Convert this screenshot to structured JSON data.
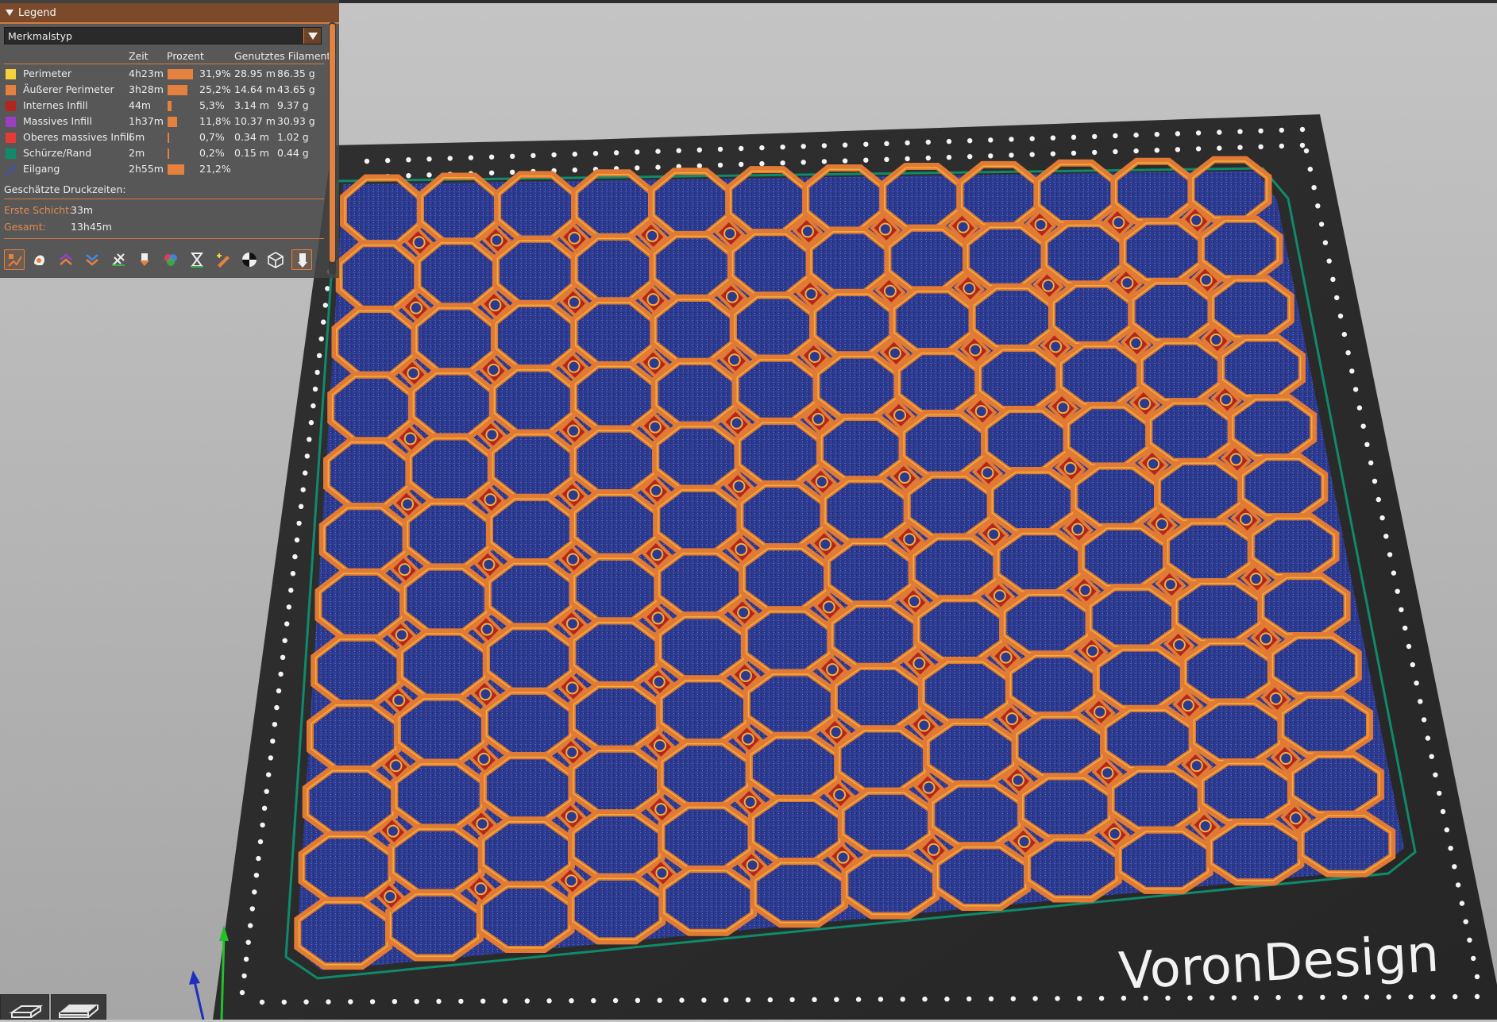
{
  "legend": {
    "title": "Legend",
    "view_type": "Merkmalstyp",
    "columns": {
      "time": "Zeit",
      "percent": "Prozent",
      "filament": "Genutztes Filament"
    },
    "rows": [
      {
        "label": "Perimeter",
        "color": "#f5d33d",
        "time": "4h23m",
        "percent": "31,9%",
        "percent_value": 31.9,
        "length": "28.95 m",
        "weight": "86.35 g"
      },
      {
        "label": "Äußerer Perimeter",
        "color": "#e5813e",
        "time": "3h28m",
        "percent": "25,2%",
        "percent_value": 25.2,
        "length": "14.64 m",
        "weight": "43.65 g"
      },
      {
        "label": "Internes Infill",
        "color": "#b3261e",
        "time": "44m",
        "percent": "5,3%",
        "percent_value": 5.3,
        "length": "3.14 m",
        "weight": "9.37 g"
      },
      {
        "label": "Massives Infill",
        "color": "#9a3fc4",
        "time": "1h37m",
        "percent": "11,8%",
        "percent_value": 11.8,
        "length": "10.37 m",
        "weight": "30.93 g"
      },
      {
        "label": "Oberes massives Infill",
        "color": "#e83a35",
        "time": "6m",
        "percent": "0,7%",
        "percent_value": 0.7,
        "length": "0.34 m",
        "weight": "1.02 g"
      },
      {
        "label": "Schürze/Rand",
        "color": "#0f8a6a",
        "time": "2m",
        "percent": "0,2%",
        "percent_value": 0.2,
        "length": "0.15 m",
        "weight": "0.44 g"
      },
      {
        "label": "Eilgang",
        "color": "#3452c8",
        "time": "2h55m",
        "percent": "21,2%",
        "percent_value": 21.2,
        "length": "",
        "weight": ""
      }
    ],
    "estimated": {
      "title": "Geschätzte Druckzeiten:",
      "first_layer_label": "Erste Schicht:",
      "first_layer_value": "33m",
      "total_label": "Gesamt:",
      "total_value": "13h45m"
    },
    "toolbar_icons": [
      "travel-icon",
      "wipe-icon",
      "retractions-icon",
      "deretractions-icon",
      "seams-icon",
      "tool-changes-icon",
      "color-changes-icon",
      "pause-prints-icon",
      "custom-gcodes-icon",
      "center-of-gravity-icon",
      "shells-icon",
      "tool-marker-icon"
    ]
  },
  "bed": {
    "brand": "VoronDesign"
  },
  "colors": {
    "accent": "#e5813e",
    "bed": "#2e2e2e",
    "travel": "#2a3a8f"
  }
}
